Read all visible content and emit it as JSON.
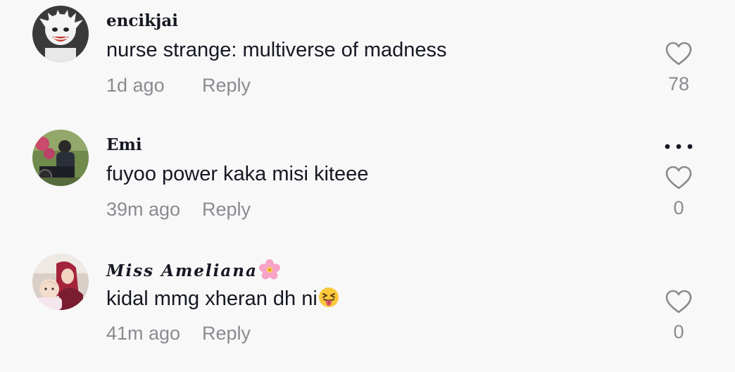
{
  "comments": [
    {
      "username": "encikjai",
      "text": "nurse strange: multiverse of madness",
      "time": "1d ago",
      "reply_label": "Reply",
      "likes": "78",
      "avatar": "cartoon-avatar"
    },
    {
      "username": "Emi",
      "text": "fuyoo power kaka misi kiteee",
      "time": "39m ago",
      "reply_label": "Reply",
      "likes": "0",
      "avatar": "photo-avatar",
      "more_icon": "ellipsis-icon"
    },
    {
      "username": "Miss Ameliana",
      "username_emoji": "cherry-blossom-icon",
      "text": "kidal mmg xheran dh ni",
      "text_emoji": "squinting-tongue-face-icon",
      "time": "41m ago",
      "reply_label": "Reply",
      "likes": "0",
      "avatar": "photo-avatar"
    }
  ],
  "colors": {
    "background": "#f8f8f8",
    "primary_text": "#161823",
    "secondary_text": "#8a8b91"
  }
}
